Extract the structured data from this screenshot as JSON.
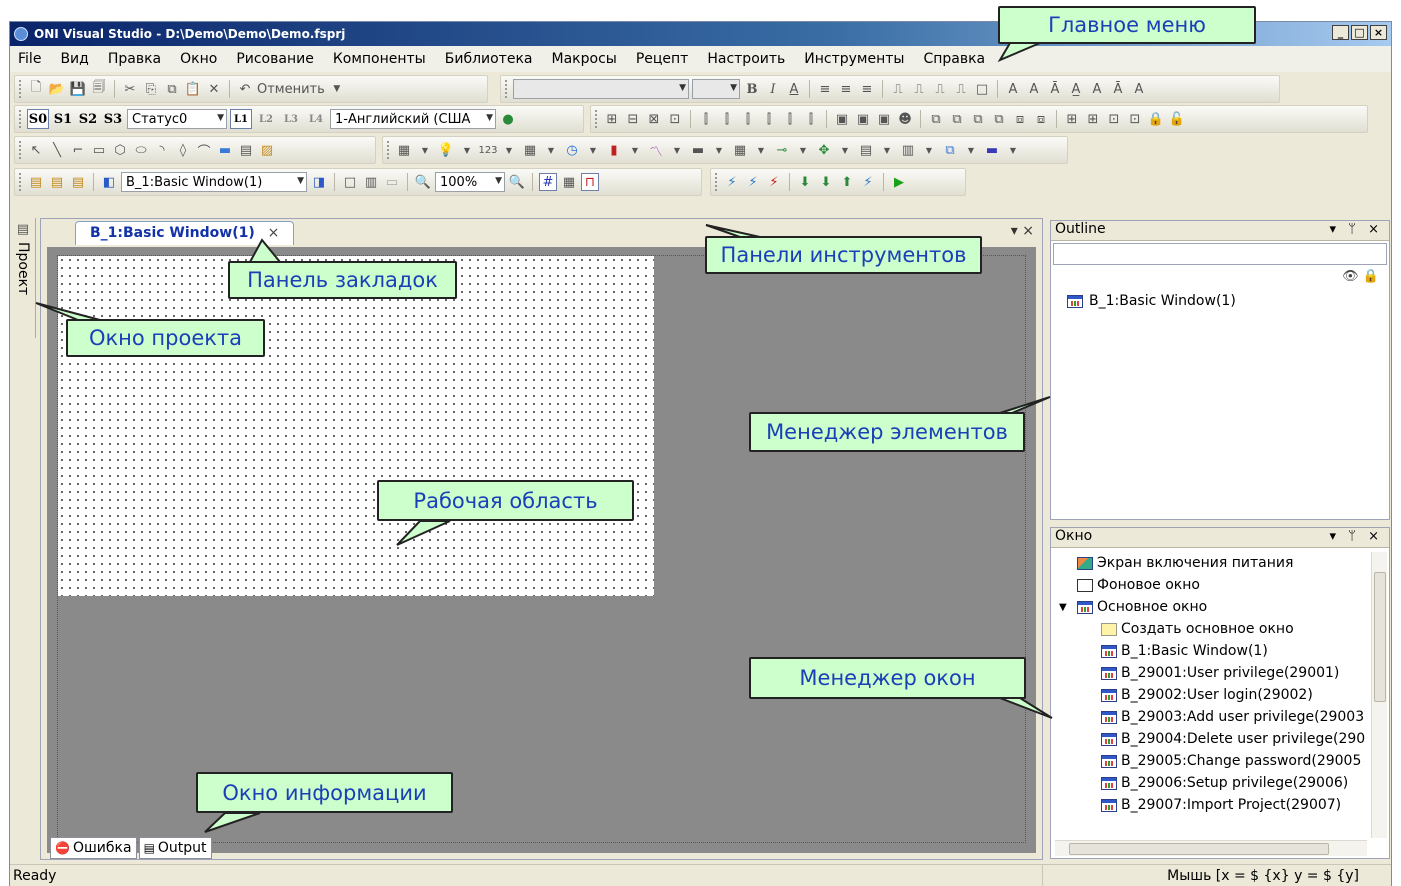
{
  "window": {
    "title": "ONI Visual Studio - D:\\Demo\\Demo\\Demo.fsprj",
    "min": "_",
    "max": "□",
    "close": "×"
  },
  "menu": [
    "File",
    "Вид",
    "Правка",
    "Окно",
    "Рисование",
    "Компоненты",
    "Библиотека",
    "Макросы",
    "Рецепт",
    "Настроить",
    "Инструменты",
    "Справка"
  ],
  "toolbar": {
    "undo_label": "Отменить",
    "status_combo": "Статус0",
    "language_combo": "1-Английский (США",
    "window_combo": "B_1:Basic Window(1)",
    "zoom_combo": "100%",
    "s_buttons": [
      "S0",
      "S1",
      "S2",
      "S3"
    ],
    "layer_buttons": [
      "L1",
      "L2",
      "L3",
      "L4"
    ]
  },
  "side_tab": {
    "label": "Проект"
  },
  "document": {
    "tab_label": "B_1:Basic Window(1)",
    "tab_close": "×",
    "controls": "▾ ×"
  },
  "bottom_tabs": [
    "Ошибка",
    "Output"
  ],
  "status": {
    "ready": "Ready",
    "mouse": "Мышь [x = $ {x} y = $ {y]"
  },
  "outline": {
    "title": "Outline",
    "controls": "▾ ᛘ ×",
    "item": "B_1:Basic Window(1)"
  },
  "windows_panel": {
    "title": "Окно",
    "controls": "▾ ᛘ ×",
    "items": [
      {
        "label": "Экран включения питания",
        "level": 1,
        "icon": "power-screen-icon"
      },
      {
        "label": "Фоновое окно",
        "level": 1,
        "icon": "background-window-icon"
      },
      {
        "label": "Основное окно",
        "level": 1,
        "icon": "main-window-icon",
        "expanded": true
      },
      {
        "label": "Создать основное окно",
        "level": 2,
        "icon": "new-window-icon"
      },
      {
        "label": "B_1:Basic Window(1)",
        "level": 2,
        "icon": "window-icon"
      },
      {
        "label": "B_29001:User privilege(29001)",
        "level": 2,
        "icon": "window-icon"
      },
      {
        "label": "B_29002:User login(29002)",
        "level": 2,
        "icon": "window-icon"
      },
      {
        "label": "B_29003:Add user privilege(29003",
        "level": 2,
        "icon": "window-icon"
      },
      {
        "label": "B_29004:Delete user privilege(290",
        "level": 2,
        "icon": "window-icon"
      },
      {
        "label": "B_29005:Change password(29005",
        "level": 2,
        "icon": "window-icon"
      },
      {
        "label": "B_29006:Setup privilege(29006)",
        "level": 2,
        "icon": "window-icon"
      },
      {
        "label": "B_29007:Import Project(29007)",
        "level": 2,
        "icon": "window-icon"
      }
    ]
  },
  "callouts": {
    "main_menu": "Главное меню",
    "toolbars": "Панели инструментов",
    "tab_bar": "Панель закладок",
    "project_window": "Окно проекта",
    "element_manager": "Менеджер элементов",
    "work_area": "Рабочая область",
    "window_manager": "Менеджер окон",
    "info_window": "Окно информации"
  },
  "colors": {
    "callout_bg": "#ccffcc",
    "callout_text": "#1a3fb8",
    "canvas_bg": "#8a8a8a",
    "titlebar": "#0a246a"
  }
}
